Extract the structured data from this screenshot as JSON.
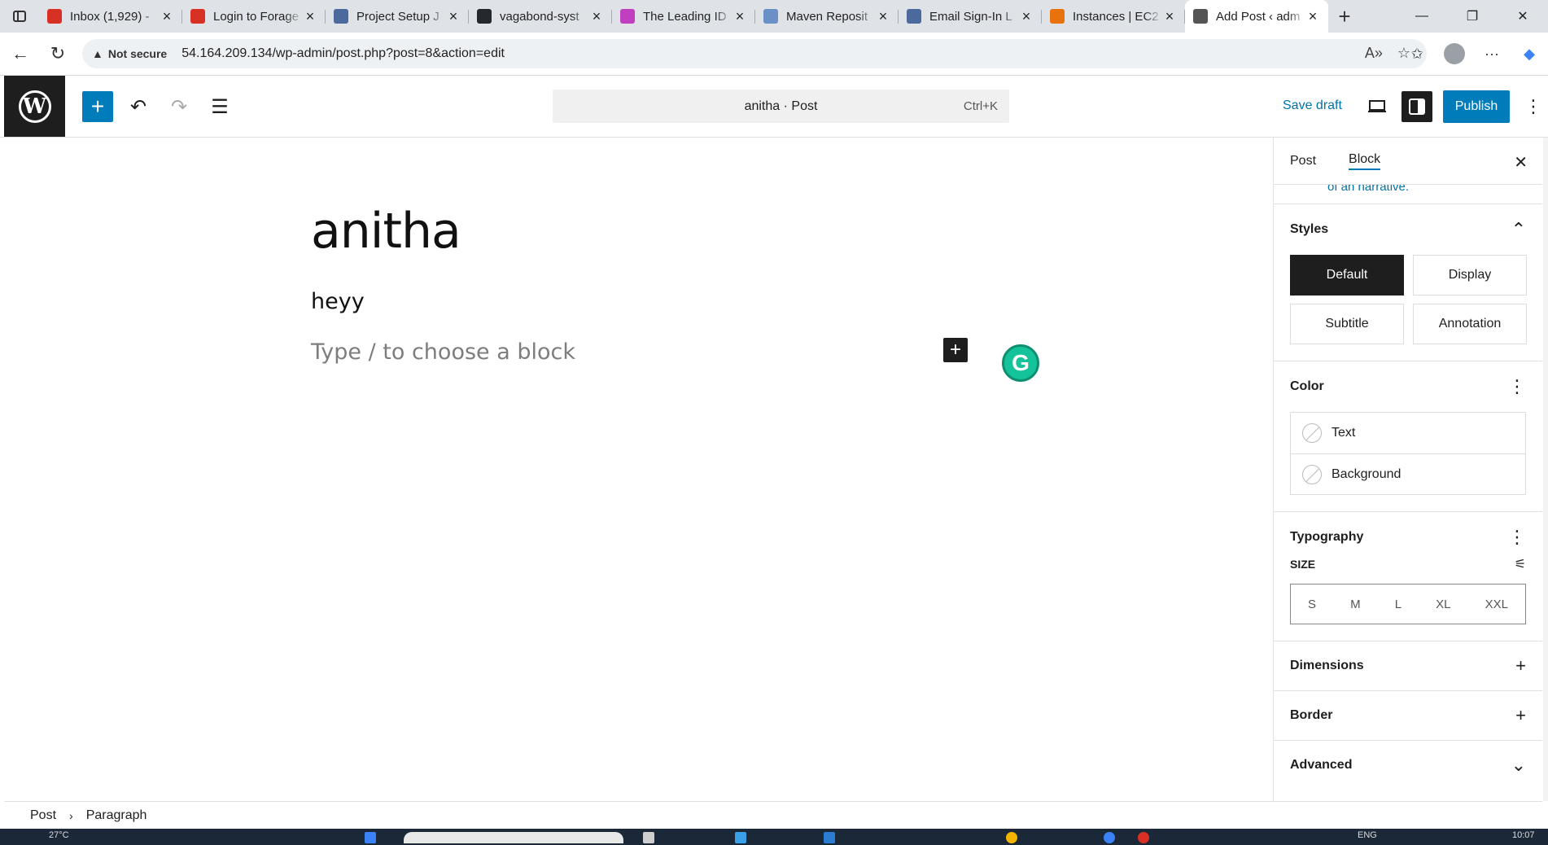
{
  "browser": {
    "tabs": [
      {
        "title": "Inbox (1,929) -",
        "favicon": "gmail-icon",
        "color": "#d93025"
      },
      {
        "title": "Login to Forage",
        "favicon": "gmail-icon",
        "color": "#d93025"
      },
      {
        "title": "Project Setup J",
        "favicon": "forage-icon",
        "color": "#4b6a9b"
      },
      {
        "title": "vagabond-syst",
        "favicon": "github-icon",
        "color": "#24292f"
      },
      {
        "title": "The Leading ID",
        "favicon": "jetbrains-icon",
        "color": "#c13fbf"
      },
      {
        "title": "Maven Reposit",
        "favicon": "maven-icon",
        "color": "#6b8fc7"
      },
      {
        "title": "Email Sign-In L",
        "favicon": "forage-icon",
        "color": "#4b6a9b"
      },
      {
        "title": "Instances | EC2",
        "favicon": "aws-icon",
        "color": "#e8730c"
      },
      {
        "title": "Add Post ‹ adm",
        "favicon": "globe-icon",
        "color": "#555555"
      }
    ],
    "new_tab": "+",
    "address": {
      "security": "Not secure",
      "url": "54.164.209.134/wp-admin/post.php?post=8&action=edit"
    }
  },
  "editor": {
    "command_bar": {
      "text": "anitha · Post",
      "shortcut": "Ctrl+K"
    },
    "save_draft": "Save draft",
    "publish": "Publish",
    "accent_color": "#007cba"
  },
  "content": {
    "title": "anitha",
    "paragraph": "heyy",
    "placeholder": "Type / to choose a block"
  },
  "sidebar": {
    "tabs": [
      "Post",
      "Block"
    ],
    "cut_text": "of an narrative.",
    "styles": {
      "heading": "Styles",
      "options": [
        "Default",
        "Display",
        "Subtitle",
        "Annotation"
      ],
      "selected": "Default"
    },
    "color": {
      "heading": "Color",
      "items": [
        "Text",
        "Background"
      ]
    },
    "typography": {
      "heading": "Typography",
      "size_label": "SIZE",
      "sizes": [
        "S",
        "M",
        "L",
        "XL",
        "XXL"
      ]
    },
    "dimensions": "Dimensions",
    "border": "Border",
    "advanced": "Advanced"
  },
  "footer": {
    "breadcrumb": [
      "Post",
      "Paragraph"
    ]
  },
  "taskbar": {
    "weather": "27°C",
    "language": "ENG",
    "time": "10:07"
  }
}
